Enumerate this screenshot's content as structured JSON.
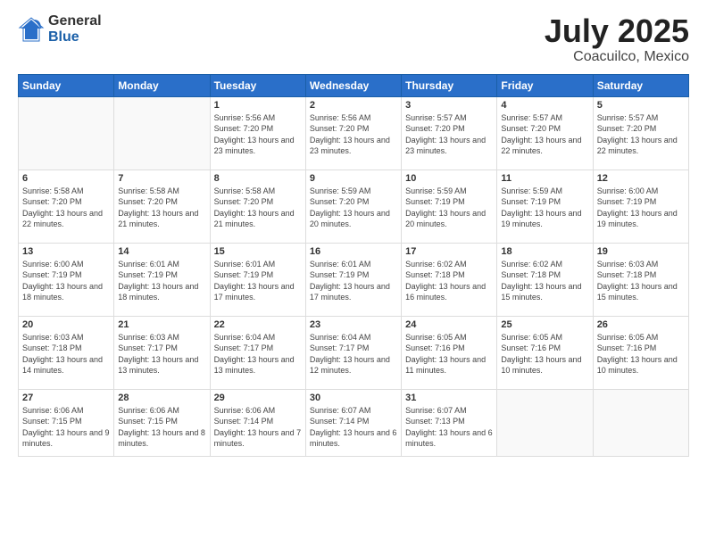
{
  "logo": {
    "general": "General",
    "blue": "Blue"
  },
  "header": {
    "month": "July 2025",
    "location": "Coacuilco, Mexico"
  },
  "weekdays": [
    "Sunday",
    "Monday",
    "Tuesday",
    "Wednesday",
    "Thursday",
    "Friday",
    "Saturday"
  ],
  "weeks": [
    [
      {
        "day": "",
        "info": ""
      },
      {
        "day": "",
        "info": ""
      },
      {
        "day": "1",
        "info": "Sunrise: 5:56 AM\nSunset: 7:20 PM\nDaylight: 13 hours and 23 minutes."
      },
      {
        "day": "2",
        "info": "Sunrise: 5:56 AM\nSunset: 7:20 PM\nDaylight: 13 hours and 23 minutes."
      },
      {
        "day": "3",
        "info": "Sunrise: 5:57 AM\nSunset: 7:20 PM\nDaylight: 13 hours and 23 minutes."
      },
      {
        "day": "4",
        "info": "Sunrise: 5:57 AM\nSunset: 7:20 PM\nDaylight: 13 hours and 22 minutes."
      },
      {
        "day": "5",
        "info": "Sunrise: 5:57 AM\nSunset: 7:20 PM\nDaylight: 13 hours and 22 minutes."
      }
    ],
    [
      {
        "day": "6",
        "info": "Sunrise: 5:58 AM\nSunset: 7:20 PM\nDaylight: 13 hours and 22 minutes."
      },
      {
        "day": "7",
        "info": "Sunrise: 5:58 AM\nSunset: 7:20 PM\nDaylight: 13 hours and 21 minutes."
      },
      {
        "day": "8",
        "info": "Sunrise: 5:58 AM\nSunset: 7:20 PM\nDaylight: 13 hours and 21 minutes."
      },
      {
        "day": "9",
        "info": "Sunrise: 5:59 AM\nSunset: 7:20 PM\nDaylight: 13 hours and 20 minutes."
      },
      {
        "day": "10",
        "info": "Sunrise: 5:59 AM\nSunset: 7:19 PM\nDaylight: 13 hours and 20 minutes."
      },
      {
        "day": "11",
        "info": "Sunrise: 5:59 AM\nSunset: 7:19 PM\nDaylight: 13 hours and 19 minutes."
      },
      {
        "day": "12",
        "info": "Sunrise: 6:00 AM\nSunset: 7:19 PM\nDaylight: 13 hours and 19 minutes."
      }
    ],
    [
      {
        "day": "13",
        "info": "Sunrise: 6:00 AM\nSunset: 7:19 PM\nDaylight: 13 hours and 18 minutes."
      },
      {
        "day": "14",
        "info": "Sunrise: 6:01 AM\nSunset: 7:19 PM\nDaylight: 13 hours and 18 minutes."
      },
      {
        "day": "15",
        "info": "Sunrise: 6:01 AM\nSunset: 7:19 PM\nDaylight: 13 hours and 17 minutes."
      },
      {
        "day": "16",
        "info": "Sunrise: 6:01 AM\nSunset: 7:19 PM\nDaylight: 13 hours and 17 minutes."
      },
      {
        "day": "17",
        "info": "Sunrise: 6:02 AM\nSunset: 7:18 PM\nDaylight: 13 hours and 16 minutes."
      },
      {
        "day": "18",
        "info": "Sunrise: 6:02 AM\nSunset: 7:18 PM\nDaylight: 13 hours and 15 minutes."
      },
      {
        "day": "19",
        "info": "Sunrise: 6:03 AM\nSunset: 7:18 PM\nDaylight: 13 hours and 15 minutes."
      }
    ],
    [
      {
        "day": "20",
        "info": "Sunrise: 6:03 AM\nSunset: 7:18 PM\nDaylight: 13 hours and 14 minutes."
      },
      {
        "day": "21",
        "info": "Sunrise: 6:03 AM\nSunset: 7:17 PM\nDaylight: 13 hours and 13 minutes."
      },
      {
        "day": "22",
        "info": "Sunrise: 6:04 AM\nSunset: 7:17 PM\nDaylight: 13 hours and 13 minutes."
      },
      {
        "day": "23",
        "info": "Sunrise: 6:04 AM\nSunset: 7:17 PM\nDaylight: 13 hours and 12 minutes."
      },
      {
        "day": "24",
        "info": "Sunrise: 6:05 AM\nSunset: 7:16 PM\nDaylight: 13 hours and 11 minutes."
      },
      {
        "day": "25",
        "info": "Sunrise: 6:05 AM\nSunset: 7:16 PM\nDaylight: 13 hours and 10 minutes."
      },
      {
        "day": "26",
        "info": "Sunrise: 6:05 AM\nSunset: 7:16 PM\nDaylight: 13 hours and 10 minutes."
      }
    ],
    [
      {
        "day": "27",
        "info": "Sunrise: 6:06 AM\nSunset: 7:15 PM\nDaylight: 13 hours and 9 minutes."
      },
      {
        "day": "28",
        "info": "Sunrise: 6:06 AM\nSunset: 7:15 PM\nDaylight: 13 hours and 8 minutes."
      },
      {
        "day": "29",
        "info": "Sunrise: 6:06 AM\nSunset: 7:14 PM\nDaylight: 13 hours and 7 minutes."
      },
      {
        "day": "30",
        "info": "Sunrise: 6:07 AM\nSunset: 7:14 PM\nDaylight: 13 hours and 6 minutes."
      },
      {
        "day": "31",
        "info": "Sunrise: 6:07 AM\nSunset: 7:13 PM\nDaylight: 13 hours and 6 minutes."
      },
      {
        "day": "",
        "info": ""
      },
      {
        "day": "",
        "info": ""
      }
    ]
  ]
}
